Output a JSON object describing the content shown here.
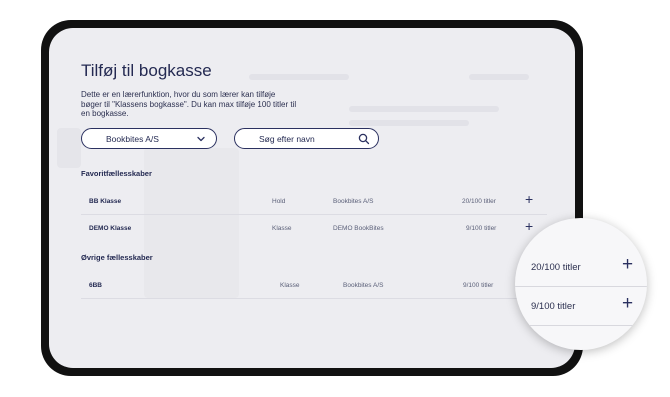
{
  "modal": {
    "title": "Tilføj til bogkasse",
    "description": "Dette er en lærerfunktion, hvor du som lærer kan tilføje bøger til \"Klassens bogkasse\". Du kan max tilføje 100 titler til en bogkasse.",
    "publisher_select": "Bookbites A/S",
    "search_placeholder": "Søg efter navn"
  },
  "favorites": {
    "heading": "Favoritfællesskaber",
    "rows": [
      {
        "name": "BB Klasse",
        "type": "Hold",
        "publisher": "Bookbites A/S",
        "count": "20/100 titler",
        "action": "+"
      },
      {
        "name": "DEMO Klasse",
        "type": "Klasse",
        "publisher": "DEMO BookBites",
        "count": "9/100 titler",
        "action": "+"
      }
    ]
  },
  "others": {
    "heading": "Øvrige fællesskaber",
    "rows": [
      {
        "name": "6BB",
        "type": "Klasse",
        "publisher": "Bookbites A/S",
        "count": "9/100 titler"
      }
    ]
  },
  "zoom": {
    "rows": [
      {
        "count": "20/100 titler",
        "action": "+"
      },
      {
        "count": "9/100 titler",
        "action": "+"
      }
    ]
  },
  "icons": {
    "dropdown": "chevron-down-icon",
    "search": "search-icon",
    "add": "plus-icon"
  }
}
